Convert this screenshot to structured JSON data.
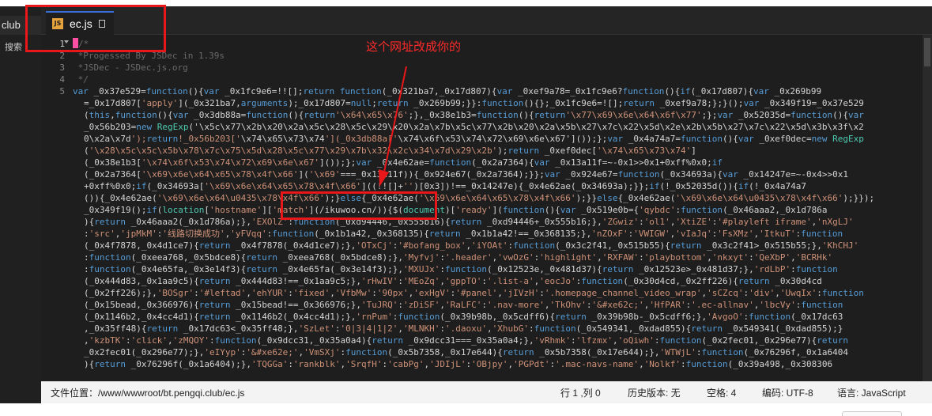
{
  "left_panel": {
    "site": "club",
    "search": "搜索"
  },
  "tab": {
    "icon_label": "JS",
    "label": "ec.js"
  },
  "annotation": {
    "note": "这个网址改成你的"
  },
  "editor": {
    "line_numbers": [
      "1",
      "2",
      "3",
      "4",
      "5"
    ],
    "lines": [
      {
        "text": "/*",
        "kind": "comment"
      },
      {
        "text": " *Progessed By JSDec in 1.39s",
        "kind": "comment"
      },
      {
        "text": " *JSDec - JSDec.js.org",
        "kind": "comment"
      },
      {
        "text": " */",
        "kind": "comment"
      },
      {
        "text": "var _0x37e529=function(){var _0x1fc9e6=!![];return function(_0x321ba7,_0x17d807){var _0xef9a78=_0x1fc9e6?function(){if(_0x17d807){var _0x269b99",
        "kind": "code"
      },
      {
        "text": "=_0x17d807['apply'](_0x321ba7,arguments);_0x17d807=null;return _0x269b99;}}:function(){};_0x1fc9e6=![];return _0xef9a78;};}();var _0x349f19=_0x37e529",
        "kind": "code"
      },
      {
        "text": "(this,function(){var _0x3db88a=function(){return'\\x64\\x65\\x76';},_0x38e1b3=function(){return'\\x77\\x69\\x6e\\x64\\x6f\\x77';};var _0x52035d=function(){var",
        "kind": "code"
      },
      {
        "text": "_0x56b203=new RegExp('\\x5c\\x77\\x2b\\x20\\x2a\\x5c\\x28\\x5c\\x29\\x20\\x2a\\x7b\\x5c\\x77\\x2b\\x20\\x2a\\x5b\\x27\\x7c\\x22\\x5d\\x2e\\x2b\\x5b\\x27\\x7c\\x22\\x5d\\x3b\\x3f\\x2",
        "kind": "code"
      },
      {
        "text": "0\\x2a\\x7d');return!_0x56b203['\\x74\\x65\\x73\\x74'](_0x3db88a['\\x74\\x6f\\x53\\x74\\x72\\x69\\x6e\\x67']());};var _0x4a74a7=function(){var _0xef0dec=new RegExp",
        "kind": "code"
      },
      {
        "text": "('\\x28\\x5c\\x5c\\x5b\\x78\\x7c\\x75\\x5d\\x28\\x5c\\x77\\x29\\x7b\\x32\\x2c\\x34\\x7d\\x29\\x2b');return _0xef0dec['\\x74\\x65\\x73\\x74']",
        "kind": "code"
      },
      {
        "text": "(_0x38e1b3['\\x74\\x6f\\x53\\x74\\x72\\x69\\x6e\\x67']());};var _0x4e62ae=function(_0x2a7364){var _0x13a11f=~-0x1>>0x1+0xff%0x0;if",
        "kind": "code"
      },
      {
        "text": "(_0x2a7364['\\x69\\x6e\\x64\\x65\\x78\\x4f\\x66']('\\x69'===_0x13a11f)){_0x924e67(_0x2a7364);}};var _0x924e67=function(_0x34693a){var _0x14247e=~-0x4>>0x1",
        "kind": "code"
      },
      {
        "text": "+0xff%0x0;if(_0x34693a['\\x69\\x6e\\x64\\x65\\x78\\x4f\\x66']((!![]+'')[0x3])!==_0x14247e){_0x4e62ae(_0x34693a);}};if(!_0x52035d()){if(!_0x4a74a7",
        "kind": "code"
      },
      {
        "text": "()){_0x4e62ae('\\x69\\x6e\\x64\\u0435\\x78\\x4f\\x66');}else{_0x4e62ae('\\x69\\x6e\\x64\\x65\\x78\\x4f\\x66');}}else{_0x4e62ae('\\x69\\x6e\\x64\\u0435\\x78\\x4f\\x66');}});",
        "kind": "code"
      },
      {
        "text": "_0x349f19();if(location['hostname']['match'](/ikuwoo.cn/)){$(document)['ready'](function(){var _0x519e0b={'qybdc':function(_0x46aaa2,_0x1d786a",
        "kind": "code"
      },
      {
        "text": "){return _0x46aaa2(_0x1d786a);},'EXOlZ':function(_0xd94446,_0x555b16){return _0xd94446+_0x555b16;},'ZGwiz':'ol1','XtiZE':'#playleft iframe','nXgLJ'",
        "kind": "code"
      },
      {
        "text": ":'src','jpMkM':'线路切换成功','yFVqq':function(_0x1b1a42,_0x368135){return _0x1b1a42!==_0x368135;},'nZOxF':'VWIGW','vIaJq':'FsXMz','ItkuT':function",
        "kind": "code"
      },
      {
        "text": "(_0x4f7878,_0x4d1ce7){return _0x4f7878(_0x4d1ce7);},'OTxCj':'#bofang_box','iYOAt':function(_0x3c2f41,_0x515b55){return _0x3c2f41>_0x515b55;},'KhCHJ'",
        "kind": "code"
      },
      {
        "text": ":function(_0xeea768,_0x5bdce8){return _0xeea768(_0x5bdce8);},'Myfvj':'.header','vwOzG':'highlight','RXFAW':'playbottom','nkxyt':'QeXbP','BCRHk'",
        "kind": "code"
      },
      {
        "text": ":function(_0x4e65fa,_0x3e14f3){return _0x4e65fa(_0x3e14f3);},'MXUJx':function(_0x12523e,_0x481d37){return _0x12523e>_0x481d37;},'rdLbP':function",
        "kind": "code"
      },
      {
        "text": "(_0x444d83,_0x1aa9c5){return _0x444d83!==_0x1aa9c5;},'rHwIV':'MEoZq','gppTO':'.list-a','eocJo':function(_0x30d4cd,_0x2ff226){return _0x30d4cd",
        "kind": "code"
      },
      {
        "text": "(_0x2ff226);},'BOSgr':'#leftad','ehYUR':'fixed','VfbMw':'90px','exHgV':'#panel','jIVzH':'.homepage_channel_video_wrap','sCZcq':'div','UwqIx':function",
        "kind": "code"
      },
      {
        "text": "(_0x15bead,_0x366976){return _0x15bead!==_0x366976;},'TuJRQ':'zDiSF','RaLFC':'.nav-more','TkOhv':'&#xe62c;','HfPAR':'.ec-allnav','lbcVy':function",
        "kind": "code"
      },
      {
        "text": "(_0x1146b2,_0x4cc4d1){return _0x1146b2(_0x4cc4d1);},'rnPum':function(_0x39b98b,_0x5cdff6){return _0x39b98b-_0x5cdff6;},'AvgoO':function(_0x17dc63",
        "kind": "code"
      },
      {
        "text": ",_0x35ff48){return _0x17dc63<_0x35ff48;},'SzLet':'0|3|4|1|2','MLNKH':'.daoxu','XhubG':function(_0x549341,_0xdad855){return _0x549341(_0xdad855);}",
        "kind": "code"
      },
      {
        "text": ",'kzbTK':'click','zMQOY':function(_0x9dcc31,_0x35a0a4){return _0x9dcc31===_0x35a0a4;},'vRhmk':'lfzmx','oQiwh':function(_0x2fec01,_0x296e77){return",
        "kind": "code"
      },
      {
        "text": "_0x2fec01(_0x296e77);},'eIYyp':'&#xe62e;','VmSXj':function(_0x5b7358,_0x17e644){return _0x5b7358(_0x17e644);},'WTWjL':function(_0x76296f,_0x1a6404",
        "kind": "code"
      },
      {
        "text": "){return _0x76296f(_0x1a6404);},'TQGGa':'rankblk','SrqfH':'cabPg','JDIjL':'OBjpy','PGPdt':'.mac-navs-name','Nolkf':function(_0x39a498,_0x308306",
        "kind": "code"
      }
    ]
  },
  "statusbar": {
    "path": "文件位置：/www/wwwroot/bt.pengqi.club/ec.js",
    "position": "行 1 ,列 0",
    "history": "历史版本: 无",
    "indent": "空格: 4",
    "encoding": "编码: UTF-8",
    "language": "语言: JavaScript"
  },
  "colors": {
    "highlight": "#e8171a",
    "note": "#ff2a2a",
    "editor_bg": "#1e1e1e"
  }
}
